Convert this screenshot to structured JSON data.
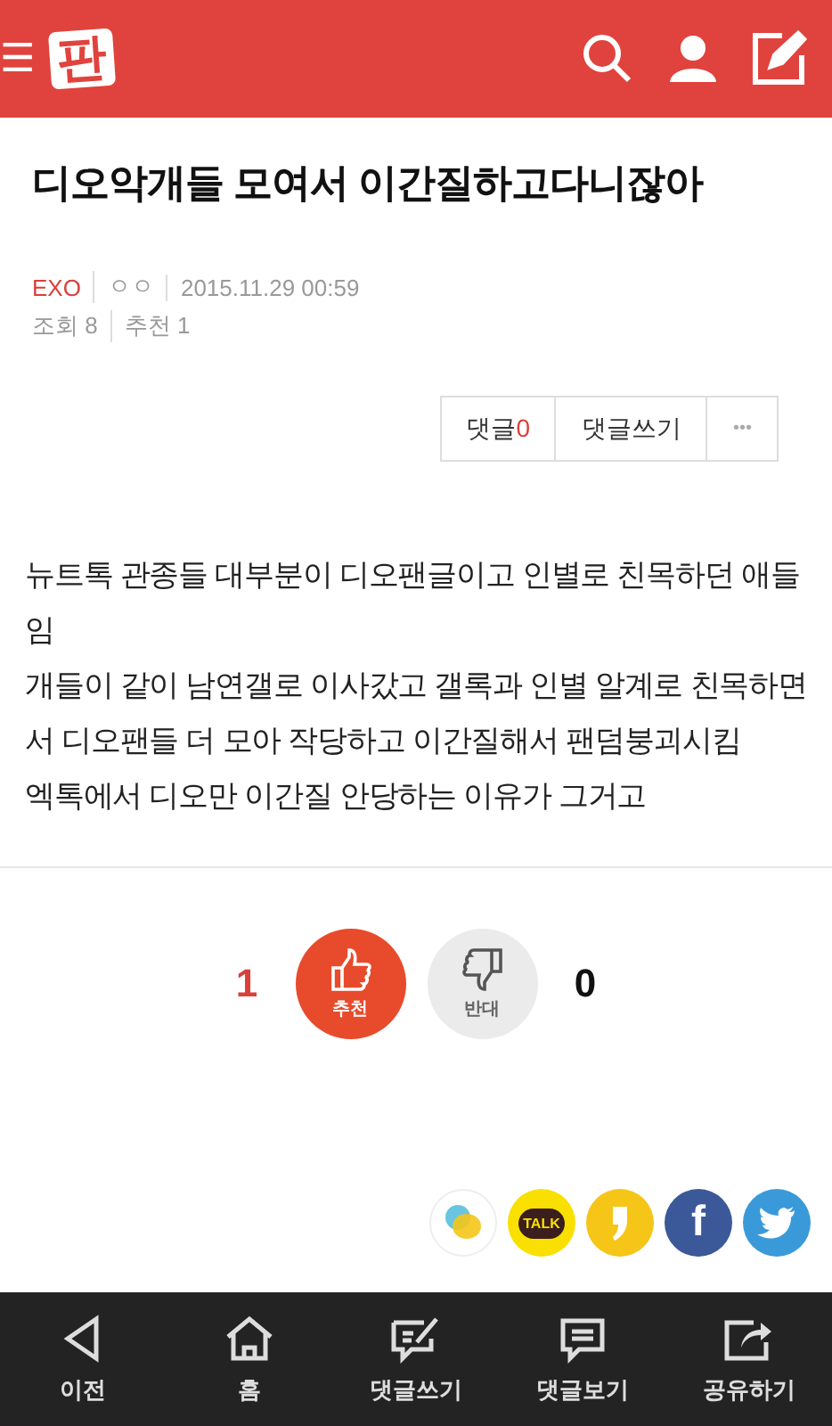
{
  "header": {
    "logo": "판",
    "menu_glyph": "☰"
  },
  "post": {
    "title": "디오악개들 모여서 이간질하고다니잖아",
    "board": "EXO",
    "author": "ㅇㅇ",
    "date": "2015.11.29 00:59",
    "views": "조회 8",
    "recommends": "추천 1"
  },
  "actions": {
    "comments_label": "댓글",
    "comments_count": "0",
    "write": "댓글쓰기",
    "more": "•••"
  },
  "body": [
    "뉴트톡 관종들 대부분이 디오팬글이고 인별로 친목하던 애들임",
    "개들이 같이 남연갤로 이사갔고 갤록과 인별 알계로 친목하면서 디오팬들 더 모아 작당하고 이간질해서 팬덤붕괴시킴",
    "엑톡에서 디오만 이간질 안당하는 이유가 그거고"
  ],
  "votes": [
    {
      "kind": "up",
      "label": "추천",
      "count": "1",
      "selected": true
    },
    {
      "kind": "down",
      "label": "반대",
      "count": "0",
      "selected": false
    }
  ],
  "share": [
    {
      "kind": "bubbles"
    },
    {
      "kind": "talk",
      "text": "TALK"
    },
    {
      "kind": "story"
    },
    {
      "kind": "facebook",
      "text": "f"
    },
    {
      "kind": "twitter"
    }
  ],
  "bottom_nav": [
    {
      "kind": "back",
      "label": "이전"
    },
    {
      "kind": "home",
      "label": "홈"
    },
    {
      "kind": "write",
      "label": "댓글쓰기"
    },
    {
      "kind": "view",
      "label": "댓글보기"
    },
    {
      "kind": "share",
      "label": "공유하기"
    }
  ]
}
